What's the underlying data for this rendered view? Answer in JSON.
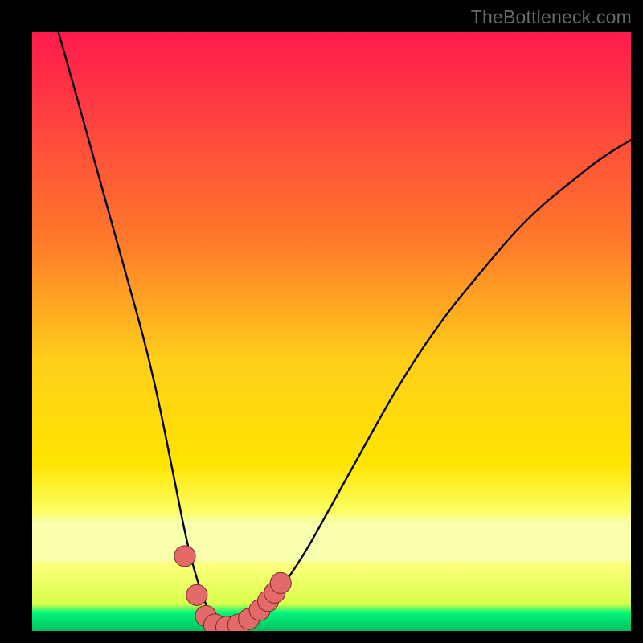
{
  "watermark": "TheBottleneck.com",
  "colors": {
    "top": "#ff1a4e",
    "mid_upper": "#ffa423",
    "mid": "#ffe400",
    "lower_yellow": "#fbff62",
    "pale_band": "#f8ffad",
    "green": "#00f57a",
    "green_deep": "#00c060",
    "curve": "#000000",
    "marker_fill": "#e46a6a",
    "marker_stroke": "#7a2a2a"
  },
  "chart_data": {
    "type": "line",
    "title": "",
    "xlabel": "",
    "ylabel": "",
    "xlim": [
      0,
      100
    ],
    "ylim": [
      0,
      100
    ],
    "series": [
      {
        "name": "curve",
        "x": [
          0,
          5,
          10,
          15,
          20,
          24,
          26,
          28,
          30,
          32,
          34,
          36,
          40,
          45,
          50,
          55,
          60,
          65,
          70,
          75,
          80,
          85,
          90,
          95,
          100
        ],
        "y": [
          115,
          98,
          80,
          62,
          44,
          24,
          14,
          7,
          2,
          0.5,
          0.5,
          1.5,
          5,
          12,
          21,
          30,
          39,
          47,
          54,
          60,
          66,
          71,
          75,
          79,
          82
        ]
      }
    ],
    "markers": [
      {
        "x": 25.5,
        "y": 12.5,
        "r": 1.2
      },
      {
        "x": 27.5,
        "y": 6.0,
        "r": 1.2
      },
      {
        "x": 29.0,
        "y": 2.5,
        "r": 1.2
      },
      {
        "x": 30.5,
        "y": 1.0,
        "r": 1.3
      },
      {
        "x": 32.5,
        "y": 0.6,
        "r": 1.3
      },
      {
        "x": 34.5,
        "y": 1.0,
        "r": 1.3
      },
      {
        "x": 36.2,
        "y": 2.0,
        "r": 1.2
      },
      {
        "x": 38.0,
        "y": 3.5,
        "r": 1.2
      },
      {
        "x": 39.4,
        "y": 5.0,
        "r": 1.2
      },
      {
        "x": 40.5,
        "y": 6.4,
        "r": 1.2
      },
      {
        "x": 41.5,
        "y": 8.0,
        "r": 1.2
      }
    ],
    "green_band": {
      "from_y": 0,
      "to_y": 4
    },
    "pale_band": {
      "from_y": 14,
      "to_y": 22
    }
  }
}
